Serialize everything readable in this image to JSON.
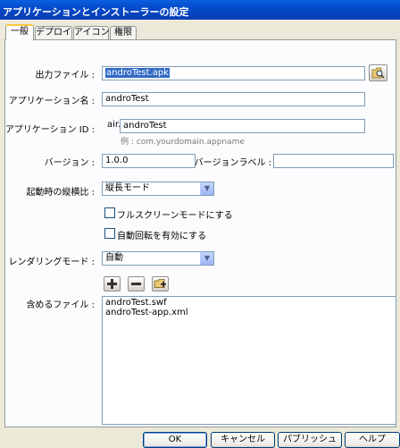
{
  "window": {
    "title": "アプリケーションとインストーラーの設定"
  },
  "tabs": [
    {
      "label": "一般"
    },
    {
      "label": "デプロイ"
    },
    {
      "label": "アイコン"
    },
    {
      "label": "権限"
    }
  ],
  "form": {
    "output_file_label": "出力ファイル :",
    "output_file_value": "androTest.apk",
    "app_name_label": "アプリケーション名 :",
    "app_name_value": "androTest",
    "app_id_label": "アプリケーション ID :",
    "app_id_prefix": "air.",
    "app_id_value": "androTest",
    "app_id_hint": "例 : com.yourdomain.appname",
    "version_label": "バージョン :",
    "version_value": "1.0.0",
    "version_label_label": "バージョンラベル :",
    "version_label_value": "",
    "aspect_label": "起動時の縦横比 :",
    "aspect_value": "縦長モード",
    "fullscreen_label": "フルスクリーンモードにする",
    "fullscreen_checked": false,
    "autorotate_label": "自動回転を有効にする",
    "autorotate_checked": false,
    "render_mode_label": "レンダリングモード :",
    "render_mode_value": "自動",
    "included_files_label": "含めるファイル :",
    "included_files": [
      "androTest.swf",
      "androTest-app.xml"
    ]
  },
  "buttons": {
    "ok": "OK",
    "cancel": "キャンセル",
    "publish": "パブリッシュ",
    "help": "ヘルプ"
  }
}
